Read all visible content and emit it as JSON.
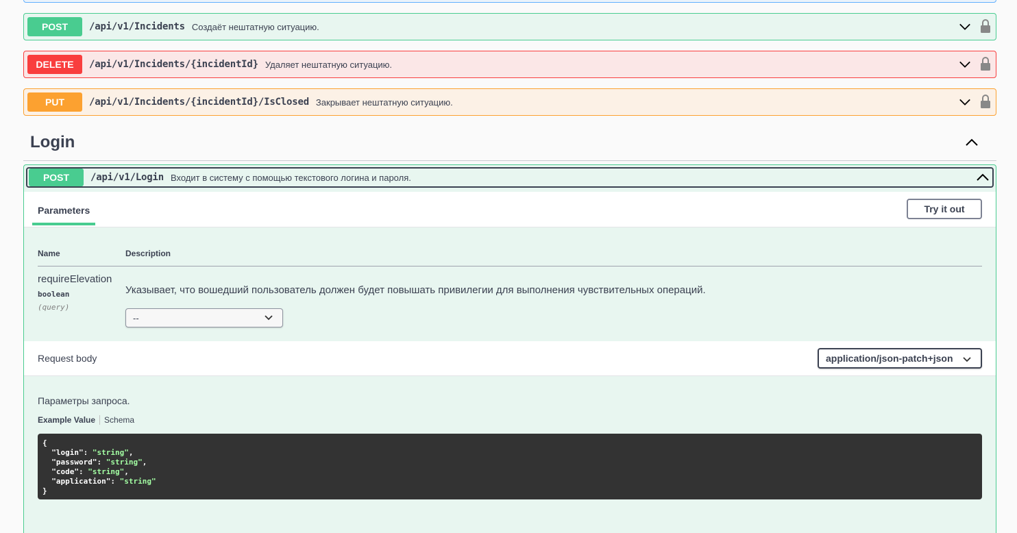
{
  "ops": [
    {
      "method": "POST",
      "path": "/api/v1/Incidents",
      "summary": "Создаёт нештатную ситуацию."
    },
    {
      "method": "DELETE",
      "path": "/api/v1/Incidents/{incidentId}",
      "summary": "Удаляет нештатную ситуацию."
    },
    {
      "method": "PUT",
      "path": "/api/v1/Incidents/{incidentId}/IsClosed",
      "summary": "Закрывает нештатную ситуацию."
    }
  ],
  "section": {
    "title": "Login"
  },
  "login": {
    "method": "POST",
    "path": "/api/v1/Login",
    "summary": "Входит в систему с помощью текстового логина и пароля.",
    "tab_parameters": "Parameters",
    "try_it_out": "Try it out",
    "col_name": "Name",
    "col_description": "Description",
    "param": {
      "name": "requireElevation",
      "type": "boolean",
      "in": "(query)",
      "description": "Указывает, что вошедший пользователь должен будет повышать привилегии для выполнения чувствительных операций.",
      "selected": "--"
    },
    "request_body_label": "Request body",
    "content_type": "application/json-patch+json",
    "body_description": "Параметры запроса.",
    "example_tab": "Example Value",
    "schema_tab": "Schema",
    "example": {
      "open": "{",
      "close": "}",
      "lines": [
        {
          "key": "\"login\"",
          "value": "\"string\"",
          "comma": ","
        },
        {
          "key": "\"password\"",
          "value": "\"string\"",
          "comma": ","
        },
        {
          "key": "\"code\"",
          "value": "\"string\"",
          "comma": ","
        },
        {
          "key": "\"application\"",
          "value": "\"string\"",
          "comma": ""
        }
      ]
    }
  },
  "colors": {
    "post": "#49cc90",
    "delete": "#f93e3e",
    "put": "#fca130",
    "text": "#3b4151"
  }
}
